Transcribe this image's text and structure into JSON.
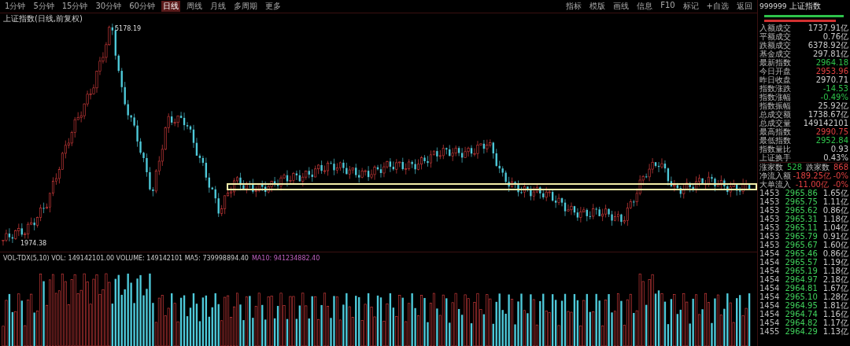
{
  "toolbar": {
    "periods": [
      {
        "label": "1分钟",
        "selected": false
      },
      {
        "label": "5分钟",
        "selected": false
      },
      {
        "label": "15分钟",
        "selected": false
      },
      {
        "label": "30分钟",
        "selected": false
      },
      {
        "label": "60分钟",
        "selected": false
      },
      {
        "label": "日线",
        "selected": true
      },
      {
        "label": "周线",
        "selected": false
      },
      {
        "label": "月线",
        "selected": false
      },
      {
        "label": "多周期",
        "selected": false
      },
      {
        "label": "更多",
        "selected": false
      }
    ],
    "tools": [
      "指标",
      "模版",
      "画线",
      "信息",
      "F10",
      "标记",
      "+自选",
      "返回"
    ]
  },
  "chart": {
    "title": "上证指数(日线,前复权)",
    "high_label": "5178.19",
    "low_label": "1974.38",
    "highlight_band": true
  },
  "volume": {
    "header": "VOL-TDX(5,10) VOL: 149142101.00 VOLUME: 149142101 MA5: 739998894.40",
    "ma10": "MA10: 941234882.40"
  },
  "quote": {
    "code": "999999",
    "name": "上证指数",
    "stats": [
      {
        "label": "入额成交",
        "value": "1737.91亿",
        "kind": "flat"
      },
      {
        "label": "平额成交",
        "value": "0.76亿",
        "kind": "flat"
      },
      {
        "label": "跌额成交",
        "value": "6378.92亿",
        "kind": "flat"
      },
      {
        "label": "基金成交",
        "value": "297.81亿",
        "kind": "flat"
      },
      {
        "label": "最新指数",
        "value": "2964.18",
        "kind": "down"
      },
      {
        "label": "今日开盘",
        "value": "2953.96",
        "kind": "up"
      },
      {
        "label": "昨日收盘",
        "value": "2970.71",
        "kind": "flat"
      },
      {
        "label": "指数涨跌",
        "value": "-14.53",
        "kind": "down"
      },
      {
        "label": "指数涨幅",
        "value": "-0.49%",
        "kind": "down"
      },
      {
        "label": "指数振幅",
        "value": "25.92亿",
        "kind": "flat"
      },
      {
        "label": "总成交额",
        "value": "1738.67亿",
        "kind": "flat"
      },
      {
        "label": "总成交量",
        "value": "149142101",
        "kind": "flat"
      },
      {
        "label": "最高指数",
        "value": "2990.75",
        "kind": "up"
      },
      {
        "label": "最低指数",
        "value": "2952.84",
        "kind": "down"
      },
      {
        "label": "指数量比",
        "value": "0.93",
        "kind": "flat"
      },
      {
        "label": "上证换手",
        "value": "0.43%",
        "kind": "flat"
      }
    ],
    "breadth": {
      "up_label": "涨家数",
      "up_value": "528",
      "down_label": "跌家数",
      "down_value": "868"
    },
    "flows": [
      {
        "label": "净流入额",
        "value": "-189.25亿",
        "pct": "-0%"
      },
      {
        "label": "大单流入",
        "value": "-11.00亿",
        "pct": "-0%"
      }
    ],
    "ticks": [
      {
        "time": "1453",
        "price": "2965.86",
        "volume": "1.65亿"
      },
      {
        "time": "1453",
        "price": "2965.75",
        "volume": "1.11亿"
      },
      {
        "time": "1453",
        "price": "2965.62",
        "volume": "0.86亿"
      },
      {
        "time": "1453",
        "price": "2965.31",
        "volume": "1.18亿"
      },
      {
        "time": "1453",
        "price": "2965.11",
        "volume": "1.04亿"
      },
      {
        "time": "1453",
        "price": "2965.79",
        "volume": "0.91亿"
      },
      {
        "time": "1453",
        "price": "2965.67",
        "volume": "1.60亿"
      },
      {
        "time": "1454",
        "price": "2965.46",
        "volume": "0.86亿"
      },
      {
        "time": "1454",
        "price": "2965.57",
        "volume": "1.19亿"
      },
      {
        "time": "1454",
        "price": "2965.19",
        "volume": "1.18亿"
      },
      {
        "time": "1454",
        "price": "2964.97",
        "volume": "2.18亿"
      },
      {
        "time": "1454",
        "price": "2964.81",
        "volume": "1.67亿"
      },
      {
        "time": "1454",
        "price": "2965.10",
        "volume": "1.28亿"
      },
      {
        "time": "1454",
        "price": "2964.95",
        "volume": "1.81亿"
      },
      {
        "time": "1454",
        "price": "2964.74",
        "volume": "1.16亿"
      },
      {
        "time": "1454",
        "price": "2964.82",
        "volume": "1.17亿"
      },
      {
        "time": "1455",
        "price": "2964.29",
        "volume": "1.13亿"
      }
    ]
  }
}
